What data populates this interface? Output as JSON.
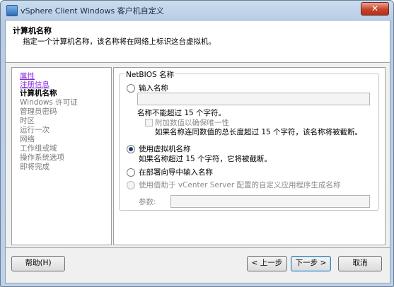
{
  "window": {
    "title": "vSphere Client Windows 客户机自定义",
    "close_glyph": "✕"
  },
  "header": {
    "title": "计算机名称",
    "description": "指定一个计算机名称，该名称将在网络上标识这台虚拟机。"
  },
  "nav": {
    "items": [
      {
        "label": "属性",
        "state": "link"
      },
      {
        "label": "注册信息",
        "state": "link"
      },
      {
        "label": "计算机名称",
        "state": "current"
      },
      {
        "label": "Windows 许可证",
        "state": "disabled"
      },
      {
        "label": "管理员密码",
        "state": "disabled"
      },
      {
        "label": "时区",
        "state": "disabled"
      },
      {
        "label": "运行一次",
        "state": "disabled"
      },
      {
        "label": "网络",
        "state": "disabled"
      },
      {
        "label": "工作组或域",
        "state": "disabled"
      },
      {
        "label": "操作系统选项",
        "state": "disabled"
      },
      {
        "label": "即将完成",
        "state": "disabled"
      }
    ]
  },
  "netbios": {
    "legend": "NetBIOS 名称",
    "options": {
      "enter_name": {
        "label": "输入名称",
        "selected": false
      },
      "use_vm_name": {
        "label": "使用虚拟机名称",
        "selected": true
      },
      "enter_in_wizard": {
        "label": "在部署向导中输入名称",
        "selected": false
      },
      "use_vcenter_app": {
        "label": "使用借助于 vCenter Server 配置的自定义应用程序生成名称",
        "selected": false,
        "enabled": false
      }
    },
    "name_value": "",
    "name_hint": "名称不能超过 15 个字符。",
    "append_unique": {
      "label": "附加数值以确保唯一性",
      "checked": false,
      "enabled": false
    },
    "append_hint": "如果名称连同数值的总长度超过 15 个字符，该名称将被截断。",
    "vm_name_hint": "如果名称超过 15 个字符，它将被截断。",
    "params_label": "参数:",
    "params_value": ""
  },
  "buttons": {
    "help": "帮助(H)",
    "back": "< 上一步",
    "next": "下一步 >",
    "cancel": "取消"
  },
  "colors": {
    "accent": "#3c7fb1",
    "link": "#8a2be2",
    "close": "#c7432b"
  }
}
